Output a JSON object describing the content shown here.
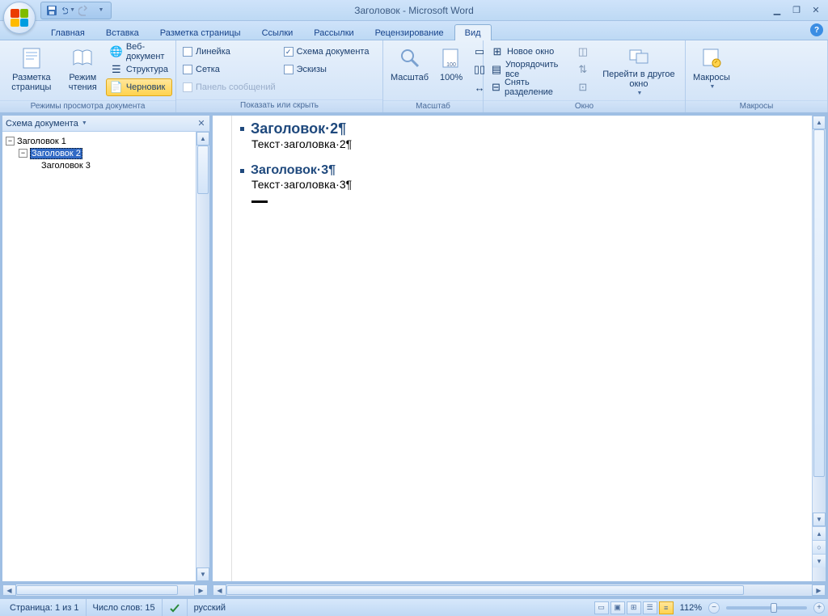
{
  "app": {
    "title": "Заголовок - Microsoft Word"
  },
  "tabs": {
    "home": "Главная",
    "insert": "Вставка",
    "layout": "Разметка страницы",
    "references": "Ссылки",
    "mailings": "Рассылки",
    "review": "Рецензирование",
    "view": "Вид"
  },
  "ribbon": {
    "views_group": "Режимы просмотра документа",
    "print_layout": "Разметка страницы",
    "reading": "Режим чтения",
    "web": "Веб-документ",
    "outline": "Структура",
    "draft": "Черновик",
    "show_group": "Показать или скрыть",
    "ruler": "Линейка",
    "gridlines": "Сетка",
    "messagebar": "Панель сообщений",
    "docmap": "Схема документа",
    "thumbnails": "Эскизы",
    "zoom_group": "Масштаб",
    "zoom": "Масштаб",
    "hundred": "100%",
    "window_group": "Окно",
    "newwin": "Новое окно",
    "arrange": "Упорядочить все",
    "split": "Снять разделение",
    "switch": "Перейти в другое окно",
    "macros_group": "Макросы",
    "macros": "Макросы"
  },
  "docmap": {
    "title": "Схема документа",
    "items": {
      "h1": "Заголовок 1",
      "h2": "Заголовок 2",
      "h3": "Заголовок 3"
    }
  },
  "document": {
    "h2": "Заголовок·2¶",
    "p2": "Текст·заголовка·2¶",
    "h3": "Заголовок·3¶",
    "p3": "Текст·заголовка·3¶"
  },
  "status": {
    "page": "Страница: 1 из 1",
    "words": "Число слов: 15",
    "lang": "русский",
    "zoom": "112%"
  }
}
